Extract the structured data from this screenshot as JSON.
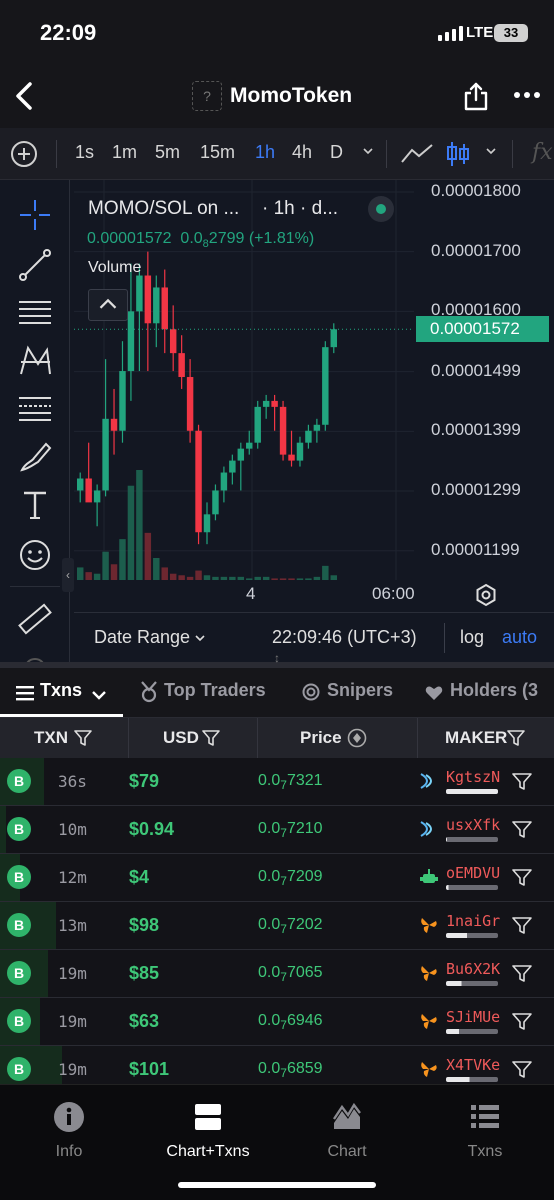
{
  "status_bar": {
    "time": "22:09",
    "network": "LTE",
    "battery": "33"
  },
  "header": {
    "title": "MomoToken",
    "logo_placeholder": "?"
  },
  "toolbar": {
    "intervals": [
      "1s",
      "1m",
      "5m",
      "15m",
      "1h",
      "4h",
      "D"
    ],
    "active_interval": "1h",
    "fx_label": "fx"
  },
  "chart": {
    "legend": {
      "symbol": "MOMO/SOL on ...",
      "interval": "· 1h · d...",
      "last_price": "0.00001572",
      "change_base": "0.0",
      "change_sub": "8",
      "change_tail": "2799 (+1.81%)",
      "volume_label": "Volume"
    },
    "current_price_label": "0.00001572",
    "time_ticks": [
      "4",
      "06:00"
    ],
    "footer": {
      "date_range": "Date Range",
      "clock": "22:09:46 (UTC+3)",
      "log": "log",
      "auto": "auto"
    },
    "accent_up": "#22a57f",
    "accent_down": "#f23645"
  },
  "chart_data": {
    "type": "candlestick",
    "yaxis_ticks": [
      "0.00001800",
      "0.00001700",
      "0.00001600",
      "0.00001499",
      "0.00001399",
      "0.00001299",
      "0.00001199"
    ],
    "ylim": [
      1.15e-05,
      1.82e-05
    ],
    "x_tick_labels": [
      "4",
      "06:00"
    ],
    "candles": [
      {
        "o": 1.3e-05,
        "h": 1.33e-05,
        "l": 1.28e-05,
        "c": 1.32e-05
      },
      {
        "o": 1.32e-05,
        "h": 1.38e-05,
        "l": 1.3e-05,
        "c": 1.28e-05
      },
      {
        "o": 1.28e-05,
        "h": 1.31e-05,
        "l": 1.24e-05,
        "c": 1.3e-05
      },
      {
        "o": 1.3e-05,
        "h": 1.52e-05,
        "l": 1.29e-05,
        "c": 1.42e-05
      },
      {
        "o": 1.42e-05,
        "h": 1.47e-05,
        "l": 1.36e-05,
        "c": 1.4e-05
      },
      {
        "o": 1.4e-05,
        "h": 1.55e-05,
        "l": 1.38e-05,
        "c": 1.5e-05
      },
      {
        "o": 1.5e-05,
        "h": 1.68e-05,
        "l": 1.45e-05,
        "c": 1.6e-05
      },
      {
        "o": 1.6e-05,
        "h": 1.68e-05,
        "l": 1.5e-05,
        "c": 1.66e-05
      },
      {
        "o": 1.66e-05,
        "h": 1.7e-05,
        "l": 1.5e-05,
        "c": 1.58e-05
      },
      {
        "o": 1.58e-05,
        "h": 1.66e-05,
        "l": 1.54e-05,
        "c": 1.64e-05
      },
      {
        "o": 1.64e-05,
        "h": 1.67e-05,
        "l": 1.53e-05,
        "c": 1.57e-05
      },
      {
        "o": 1.57e-05,
        "h": 1.61e-05,
        "l": 1.5e-05,
        "c": 1.53e-05
      },
      {
        "o": 1.53e-05,
        "h": 1.56e-05,
        "l": 1.47e-05,
        "c": 1.49e-05
      },
      {
        "o": 1.49e-05,
        "h": 1.52e-05,
        "l": 1.38e-05,
        "c": 1.4e-05
      },
      {
        "o": 1.4e-05,
        "h": 1.41e-05,
        "l": 1.21e-05,
        "c": 1.23e-05
      },
      {
        "o": 1.23e-05,
        "h": 1.28e-05,
        "l": 1.21e-05,
        "c": 1.26e-05
      },
      {
        "o": 1.26e-05,
        "h": 1.31e-05,
        "l": 1.25e-05,
        "c": 1.3e-05
      },
      {
        "o": 1.3e-05,
        "h": 1.34e-05,
        "l": 1.28e-05,
        "c": 1.33e-05
      },
      {
        "o": 1.33e-05,
        "h": 1.36e-05,
        "l": 1.31e-05,
        "c": 1.35e-05
      },
      {
        "o": 1.35e-05,
        "h": 1.38e-05,
        "l": 1.3e-05,
        "c": 1.37e-05
      },
      {
        "o": 1.37e-05,
        "h": 1.4e-05,
        "l": 1.36e-05,
        "c": 1.38e-05
      },
      {
        "o": 1.38e-05,
        "h": 1.45e-05,
        "l": 1.37e-05,
        "c": 1.44e-05
      },
      {
        "o": 1.44e-05,
        "h": 1.46e-05,
        "l": 1.42e-05,
        "c": 1.45e-05
      },
      {
        "o": 1.45e-05,
        "h": 1.46e-05,
        "l": 1.4e-05,
        "c": 1.44e-05
      },
      {
        "o": 1.44e-05,
        "h": 1.45e-05,
        "l": 1.35e-05,
        "c": 1.36e-05
      },
      {
        "o": 1.36e-05,
        "h": 1.4e-05,
        "l": 1.34e-05,
        "c": 1.35e-05
      },
      {
        "o": 1.35e-05,
        "h": 1.39e-05,
        "l": 1.34e-05,
        "c": 1.38e-05
      },
      {
        "o": 1.38e-05,
        "h": 1.41e-05,
        "l": 1.37e-05,
        "c": 1.4e-05
      },
      {
        "o": 1.4e-05,
        "h": 1.42e-05,
        "l": 1.38e-05,
        "c": 1.41e-05
      },
      {
        "o": 1.41e-05,
        "h": 1.55e-05,
        "l": 1.4e-05,
        "c": 1.54e-05
      },
      {
        "o": 1.54e-05,
        "h": 1.58e-05,
        "l": 1.53e-05,
        "c": 1.57e-05
      }
    ],
    "volumes": [
      8,
      5,
      4,
      18,
      10,
      26,
      60,
      70,
      30,
      14,
      8,
      4,
      3,
      2,
      6,
      3,
      2,
      2,
      2,
      2,
      1,
      2,
      2,
      1,
      1,
      1,
      1,
      1,
      2,
      9,
      3
    ]
  },
  "tabs": [
    "Txns",
    "Top Traders",
    "Snipers",
    "Holders (3"
  ],
  "table": {
    "headers": [
      "TXN",
      "USD",
      "Price",
      "MAKER"
    ],
    "rows": [
      {
        "type": "B",
        "age": "36s",
        "usd": "$79",
        "price_base": "0.0",
        "price_sub": "7",
        "price_tail": "7321",
        "maker": "KgtszN",
        "maker_icon": "jupiter-icon",
        "bar": 1.0
      },
      {
        "type": "B",
        "age": "10m",
        "usd": "$0.94",
        "price_base": "0.0",
        "price_sub": "7",
        "price_tail": "7210",
        "maker": "usxXfk",
        "maker_icon": "jupiter-icon",
        "bar": 0.02
      },
      {
        "type": "B",
        "age": "12m",
        "usd": "$4",
        "price_base": "0.0",
        "price_sub": "7",
        "price_tail": "7209",
        "maker": "oEMDVU",
        "maker_icon": "bot-icon",
        "bar": 0.05
      },
      {
        "type": "B",
        "age": "13m",
        "usd": "$98",
        "price_base": "0.0",
        "price_sub": "7",
        "price_tail": "7202",
        "maker": "1naiGr",
        "maker_icon": "raydium-icon",
        "bar": 0.4
      },
      {
        "type": "B",
        "age": "19m",
        "usd": "$85",
        "price_base": "0.0",
        "price_sub": "7",
        "price_tail": "7065",
        "maker": "Bu6X2K",
        "maker_icon": "raydium-icon",
        "bar": 0.3
      },
      {
        "type": "B",
        "age": "19m",
        "usd": "$63",
        "price_base": "0.0",
        "price_sub": "7",
        "price_tail": "6946",
        "maker": "SJiMUe",
        "maker_icon": "raydium-icon",
        "bar": 0.25
      },
      {
        "type": "B",
        "age": "19m",
        "usd": "$101",
        "price_base": "0.0",
        "price_sub": "7",
        "price_tail": "6859",
        "maker": "X4TVKe",
        "maker_icon": "raydium-icon",
        "bar": 0.45
      }
    ]
  },
  "bottom_nav": [
    {
      "label": "Info",
      "icon": "info-icon"
    },
    {
      "label": "Chart+Txns",
      "icon": "chart-txns-icon",
      "active": true
    },
    {
      "label": "Chart",
      "icon": "chart-icon"
    },
    {
      "label": "Txns",
      "icon": "list-icon"
    }
  ]
}
